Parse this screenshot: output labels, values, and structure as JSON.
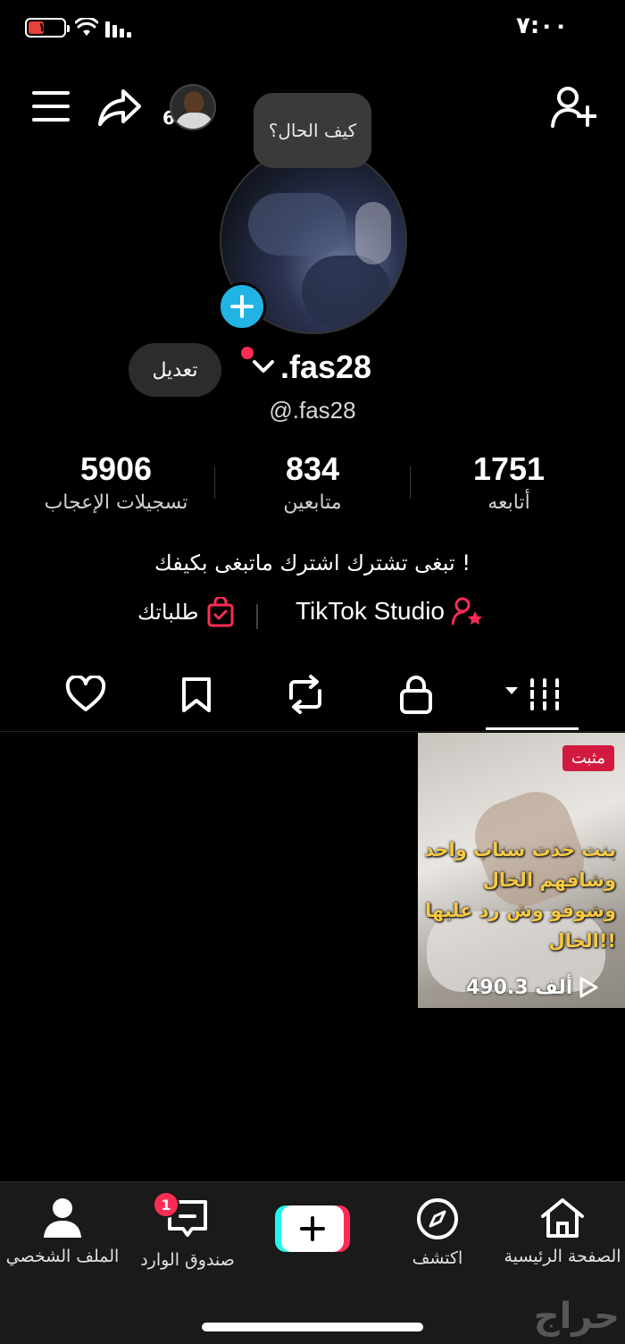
{
  "status_bar": {
    "time": "٧:٠٠",
    "battery": "١٣"
  },
  "header": {
    "story_count": "6"
  },
  "profile": {
    "note_bubble": "كيف الحال؟",
    "display_name": ".fas28",
    "username": "@.fas28",
    "edit_label": "تعديل",
    "bio": "تبغى تشترك اشترك ماتبغى بكيفك !"
  },
  "stats": {
    "following": {
      "value": "1751",
      "label": "أتابعه"
    },
    "followers": {
      "value": "834",
      "label": "متابعين"
    },
    "likes": {
      "value": "5906",
      "label": "تسجيلات الإعجاب"
    }
  },
  "links": {
    "studio": "TikTok Studio",
    "orders": "طلباتك"
  },
  "tabs": [
    "videos-icon",
    "lock-icon",
    "repost-icon",
    "bookmark-icon",
    "heart-icon"
  ],
  "videos": [
    {
      "badge": "مثبت",
      "caption": "بنت خذت سناب واحد وشافهم الخال وشوفو وش رد عليها الخال!!",
      "views": "490.3 ألف"
    }
  ],
  "bottom_nav": {
    "home": "الصفحة الرئيسية",
    "explore": "اكتشف",
    "inbox": "صندوق الوارد",
    "inbox_badge": "1",
    "profile": "الملف الشخصي"
  },
  "watermark": "حراج",
  "colors": {
    "accent": "#fe2c55",
    "cyan": "#25f4ee",
    "avatar_add": "#20b3e3",
    "pinned_badge": "#d2193f"
  }
}
